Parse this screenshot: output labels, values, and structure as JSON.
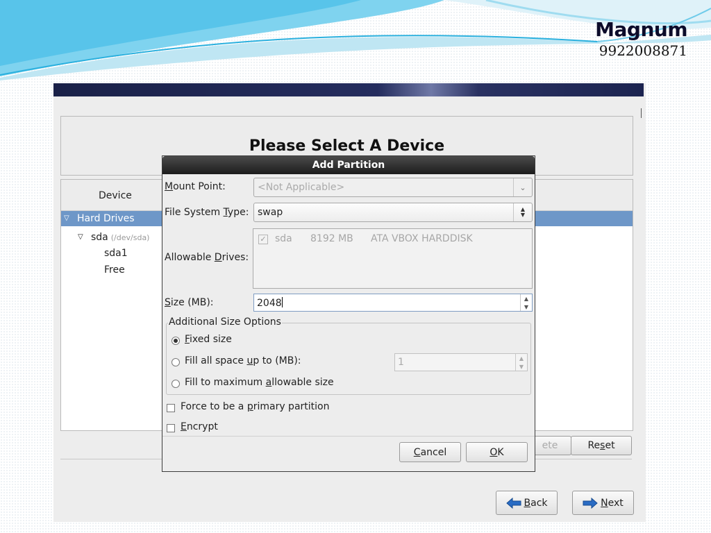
{
  "brand": {
    "name": "Magnum",
    "phone": "9922008871"
  },
  "installer": {
    "title": "Please Select A Device",
    "column_device": "Device",
    "tree": [
      {
        "label": "Hard Drives",
        "selected": true
      },
      {
        "label": "sda",
        "dev": "(/dev/sda)"
      },
      {
        "label": "sda1"
      },
      {
        "label": "Free"
      }
    ],
    "delete_label": "ete",
    "reset_pre": "Re",
    "reset_u": "s",
    "reset_post": "et",
    "back_u": "B",
    "back_post": "ack",
    "next_u": "N",
    "next_post": "ext"
  },
  "dialog": {
    "title": "Add Partition",
    "mount_u": "M",
    "mount_rest": "ount Point:",
    "mount_value": "<Not Applicable>",
    "fstype_pre": "File System ",
    "fstype_u": "T",
    "fstype_post": "ype:",
    "fstype_value": "swap",
    "drives_pre": "Allowable ",
    "drives_u": "D",
    "drives_post": "rives:",
    "drive_row": {
      "name": "sda",
      "size": "8192 MB",
      "model": "ATA VBOX HARDDISK"
    },
    "size_u": "S",
    "size_rest": "ize (MB):",
    "size_value": "2048",
    "options_legend": "Additional Size Options",
    "opt_fixed_u": "F",
    "opt_fixed_rest": "ixed size",
    "opt_fill_pre": "Fill all space ",
    "opt_fill_u": "u",
    "opt_fill_post": "p to (MB):",
    "opt_fill_value": "1",
    "opt_max_pre": "Fill to maximum ",
    "opt_max_u": "a",
    "opt_max_post": "llowable size",
    "primary_pre": "Force to be a ",
    "primary_u": "p",
    "primary_post": "rimary partition",
    "encrypt_u": "E",
    "encrypt_rest": "ncrypt",
    "cancel_u": "C",
    "cancel_rest": "ancel",
    "ok_u": "O",
    "ok_rest": "K"
  },
  "colors": {
    "selection": "#6e97c8",
    "titlebar": "#1c1c1c",
    "accent_arrow": "#2a6cc4"
  }
}
